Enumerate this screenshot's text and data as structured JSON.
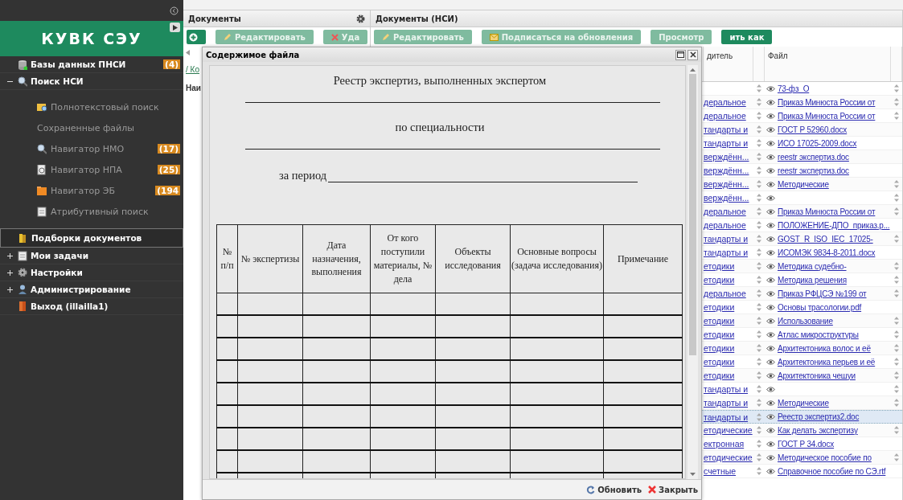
{
  "sidebar": {
    "logo": "КУВК СЭУ",
    "items": [
      {
        "kind": "link",
        "label": "Базы данных ПНСИ",
        "badge": "(4)",
        "selected": false
      },
      {
        "kind": "group",
        "label": "Поиск НСИ",
        "expanded": true,
        "selected": false,
        "children": [
          {
            "label": "Полнотекстовый поиск"
          },
          {
            "label": "Сохраненные файлы"
          },
          {
            "label": "Навигатор НМО",
            "badge": "(17)"
          },
          {
            "label": "Навигатор НПА",
            "badge": "(25)"
          },
          {
            "label": "Навигатор ЭБ",
            "badge": "(194"
          },
          {
            "label": "Атрибутивный поиск"
          }
        ]
      },
      {
        "kind": "link",
        "label": "Подборки документов",
        "selected": true
      },
      {
        "kind": "group",
        "label": "Мои задачи",
        "expanded": false,
        "selected": false
      },
      {
        "kind": "group",
        "label": "Настройки",
        "expanded": false,
        "selected": false
      },
      {
        "kind": "group",
        "label": "Администрирование",
        "expanded": false,
        "selected": false
      },
      {
        "kind": "link",
        "label": "Выход (illailla1)",
        "selected": false
      }
    ]
  },
  "panels": [
    {
      "title": "Документы",
      "toolbar": [
        {
          "kind": "add",
          "disabled": false
        },
        {
          "kind": "edit",
          "label": "Редактировать",
          "disabled": true
        },
        {
          "kind": "delete",
          "label": "Уда",
          "disabled": true
        }
      ],
      "breadcrumb": "/ Ко",
      "column_header": "Наи"
    },
    {
      "title": "Документы (НСИ)",
      "toolbar": [
        {
          "kind": "edit",
          "label": "Редактировать",
          "disabled": true
        },
        {
          "kind": "subscribe",
          "label": "Подписаться на обновления",
          "disabled": true
        },
        {
          "kind": "view",
          "label": "Просмотр",
          "disabled": true
        },
        {
          "kind": "save",
          "label": "ить как",
          "disabled": false
        }
      ],
      "table": {
        "columns": [
          "дитель",
          "Файл"
        ],
        "rows": [
          {
            "column_1": "",
            "file": "73-фз_О",
            "more_arrows": true,
            "selected": false
          },
          {
            "column_1": "деральное",
            "file": "Приказ Минюста России от",
            "more_arrows": true,
            "selected": false
          },
          {
            "column_1": "деральное",
            "file": "Приказ Минюста России от",
            "more_arrows": true,
            "selected": false
          },
          {
            "column_1": "тандарты и",
            "file": "ГОСТ Р 52960.docx",
            "more_arrows": false,
            "selected": false
          },
          {
            "column_1": "тандарты и",
            "file": "ИСО 17025-2009.docx",
            "more_arrows": false,
            "selected": false
          },
          {
            "column_1": "верждённ...",
            "file": "reestr экспертиз.doc",
            "more_arrows": false,
            "selected": false
          },
          {
            "column_1": "верждённ...",
            "file": "reestr экспертиз.doc",
            "more_arrows": false,
            "selected": false
          },
          {
            "column_1": "верждённ...",
            "file": "Методические",
            "more_arrows": true,
            "selected": false
          },
          {
            "column_1": "верждённ...",
            "file": "",
            "more_arrows": true,
            "selected": false
          },
          {
            "column_1": "деральное",
            "file": "Приказ Минюста России от",
            "more_arrows": true,
            "selected": false
          },
          {
            "column_1": "деральное",
            "file": "ПОЛОЖЕНИЕ-ДПО_приказ.р...",
            "more_arrows": false,
            "selected": false
          },
          {
            "column_1": "тандарты и",
            "file": "GOST_R_ISO_IEC_17025-",
            "more_arrows": true,
            "selected": false
          },
          {
            "column_1": "тандарты и",
            "file": "ИСОМЭК 9834-8-2011.docx",
            "more_arrows": false,
            "selected": false
          },
          {
            "column_1": "етодики",
            "file": "Методика судебно-",
            "more_arrows": true,
            "selected": false
          },
          {
            "column_1": "етодики",
            "file": "Методика решения",
            "more_arrows": true,
            "selected": false
          },
          {
            "column_1": "деральное",
            "file": "Приказ РФЦСЭ №199 от",
            "more_arrows": true,
            "selected": false
          },
          {
            "column_1": "етодики",
            "file": "Основы трасологии.pdf",
            "more_arrows": false,
            "selected": false
          },
          {
            "column_1": "етодики",
            "file": "Использование",
            "more_arrows": true,
            "selected": false
          },
          {
            "column_1": "етодики",
            "file": "Атлас микроструктуры",
            "more_arrows": true,
            "selected": false
          },
          {
            "column_1": "етодики",
            "file": "Архитектоника волос и её",
            "more_arrows": true,
            "selected": false
          },
          {
            "column_1": "етодики",
            "file": "Архитектоника перьев и её",
            "more_arrows": true,
            "selected": false
          },
          {
            "column_1": "етодики",
            "file": "Архитектоника чешуи",
            "more_arrows": true,
            "selected": false
          },
          {
            "column_1": "тандарты и",
            "file": "",
            "more_arrows": true,
            "selected": false
          },
          {
            "column_1": "тандарты и",
            "file": "Методические",
            "more_arrows": true,
            "selected": false
          },
          {
            "column_1": "тандарты и",
            "file": "Реестр экспертиз2.doc",
            "more_arrows": false,
            "selected": true
          },
          {
            "column_1": "етодические",
            "file": "Как делать экспертизу",
            "more_arrows": true,
            "selected": false
          },
          {
            "column_1": "ектронная",
            "file": "ГОСТ Р 34.docx",
            "more_arrows": false,
            "selected": false
          },
          {
            "column_1": "етодические",
            "file": "Методическое пособие по",
            "more_arrows": true,
            "selected": false
          },
          {
            "column_1": "счетные",
            "file": "Справочное пособие по СЭ.rtf",
            "more_arrows": false,
            "selected": false
          }
        ]
      }
    }
  ],
  "dialog": {
    "title": "Содержимое файла",
    "document": {
      "heading": "Реестр экспертиз, выполненных экспертом",
      "subheading": "по специальности",
      "period_label": "за период",
      "table_columns": [
        "№ п/п",
        "№ экспертизы",
        "Дата назначения, выполнения",
        "От кого поступили материалы, № дела",
        "Объекты исследования",
        "Основные вопросы (задача исследования)",
        "Примечание"
      ]
    },
    "buttons": [
      {
        "kind": "refresh",
        "label": "Обновить"
      },
      {
        "kind": "close",
        "label": "Закрыть"
      }
    ]
  }
}
